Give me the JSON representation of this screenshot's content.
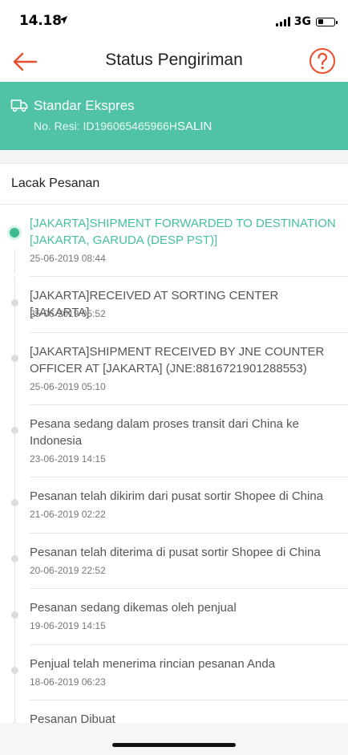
{
  "status_bar": {
    "time": "14.18",
    "network": "3G",
    "icons": [
      "location-arrow-icon",
      "signal-icon",
      "battery-icon"
    ]
  },
  "nav": {
    "title": "Status Pengiriman",
    "back_icon": "back-arrow-icon",
    "help_icon": "question-circle-icon"
  },
  "shipping": {
    "service": "Standar Ekspres",
    "resi_label": "No. Resi: ID196065465966H",
    "copy_label": "SALIN",
    "icon": "truck-icon"
  },
  "tracking": {
    "header": "Lacak Pesanan",
    "events": [
      {
        "status": "[JAKARTA]SHIPMENT FORWARDED TO DESTINATION [JAKARTA, GARUDA (DESP PST)]",
        "time": "25-06-2019 08:44",
        "active": true
      },
      {
        "status": "[JAKARTA]RECEIVED AT SORTING CENTER [JAKARTA]",
        "time": "25-06-2019 05:52",
        "active": false
      },
      {
        "status": "[JAKARTA]SHIPMENT RECEIVED BY JNE COUNTER OFFICER AT [JAKARTA] (JNE:8816721901288553)",
        "time": "25-06-2019 05:10",
        "active": false
      },
      {
        "status": "Pesana sedang dalam proses transit dari China ke Indonesia",
        "time": "23-06-2019 14:15",
        "active": false
      },
      {
        "status": "Pesanan telah dikirim dari pusat sortir Shopee di China",
        "time": "21-06-2019 02:22",
        "active": false
      },
      {
        "status": "Pesanan telah diterima di pusat sortir Shopee di China",
        "time": "20-06-2019 22:52",
        "active": false
      },
      {
        "status": "Pesanan sedang dikemas oleh penjual",
        "time": "19-06-2019 14:15",
        "active": false
      },
      {
        "status": "Penjual telah menerima rincian pesanan Anda",
        "time": "18-06-2019 06:23",
        "active": false
      },
      {
        "status": "Pesanan Dibuat",
        "time": "",
        "active": false
      }
    ]
  },
  "colors": {
    "brand_orange": "#ee4d2d",
    "shipping_green": "#50c2a5",
    "active_green": "#3fbb94"
  }
}
